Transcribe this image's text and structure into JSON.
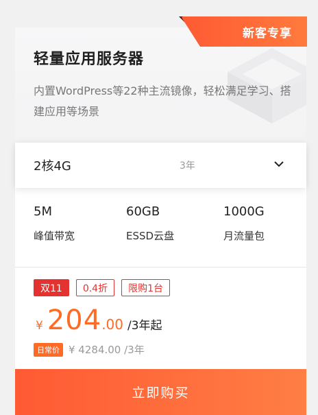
{
  "badge": {
    "label": "新客专享"
  },
  "product": {
    "title": "轻量应用服务器",
    "description": "内置WordPress等22种主流镜像，轻松满足学习、搭建应用等场景"
  },
  "selector": {
    "spec": "2核4G",
    "term": "3年"
  },
  "specs": [
    {
      "value": "5M",
      "label": "峰值带宽"
    },
    {
      "value": "60GB",
      "label": "ESSD云盘"
    },
    {
      "value": "1000G",
      "label": "月流量包"
    }
  ],
  "tags": [
    "双11",
    "0.4折",
    "限购1台"
  ],
  "price": {
    "currency": "¥",
    "integer": "204",
    "decimal": ".00",
    "unit": "/3年起"
  },
  "regular": {
    "label": "日常价",
    "price": "¥ 4284.00 /3年"
  },
  "buy_button": {
    "label": "立即购买"
  },
  "colors": {
    "accent": "#ff6a24",
    "tag_red": "#e3322f",
    "badge_start": "#ff5a33"
  }
}
